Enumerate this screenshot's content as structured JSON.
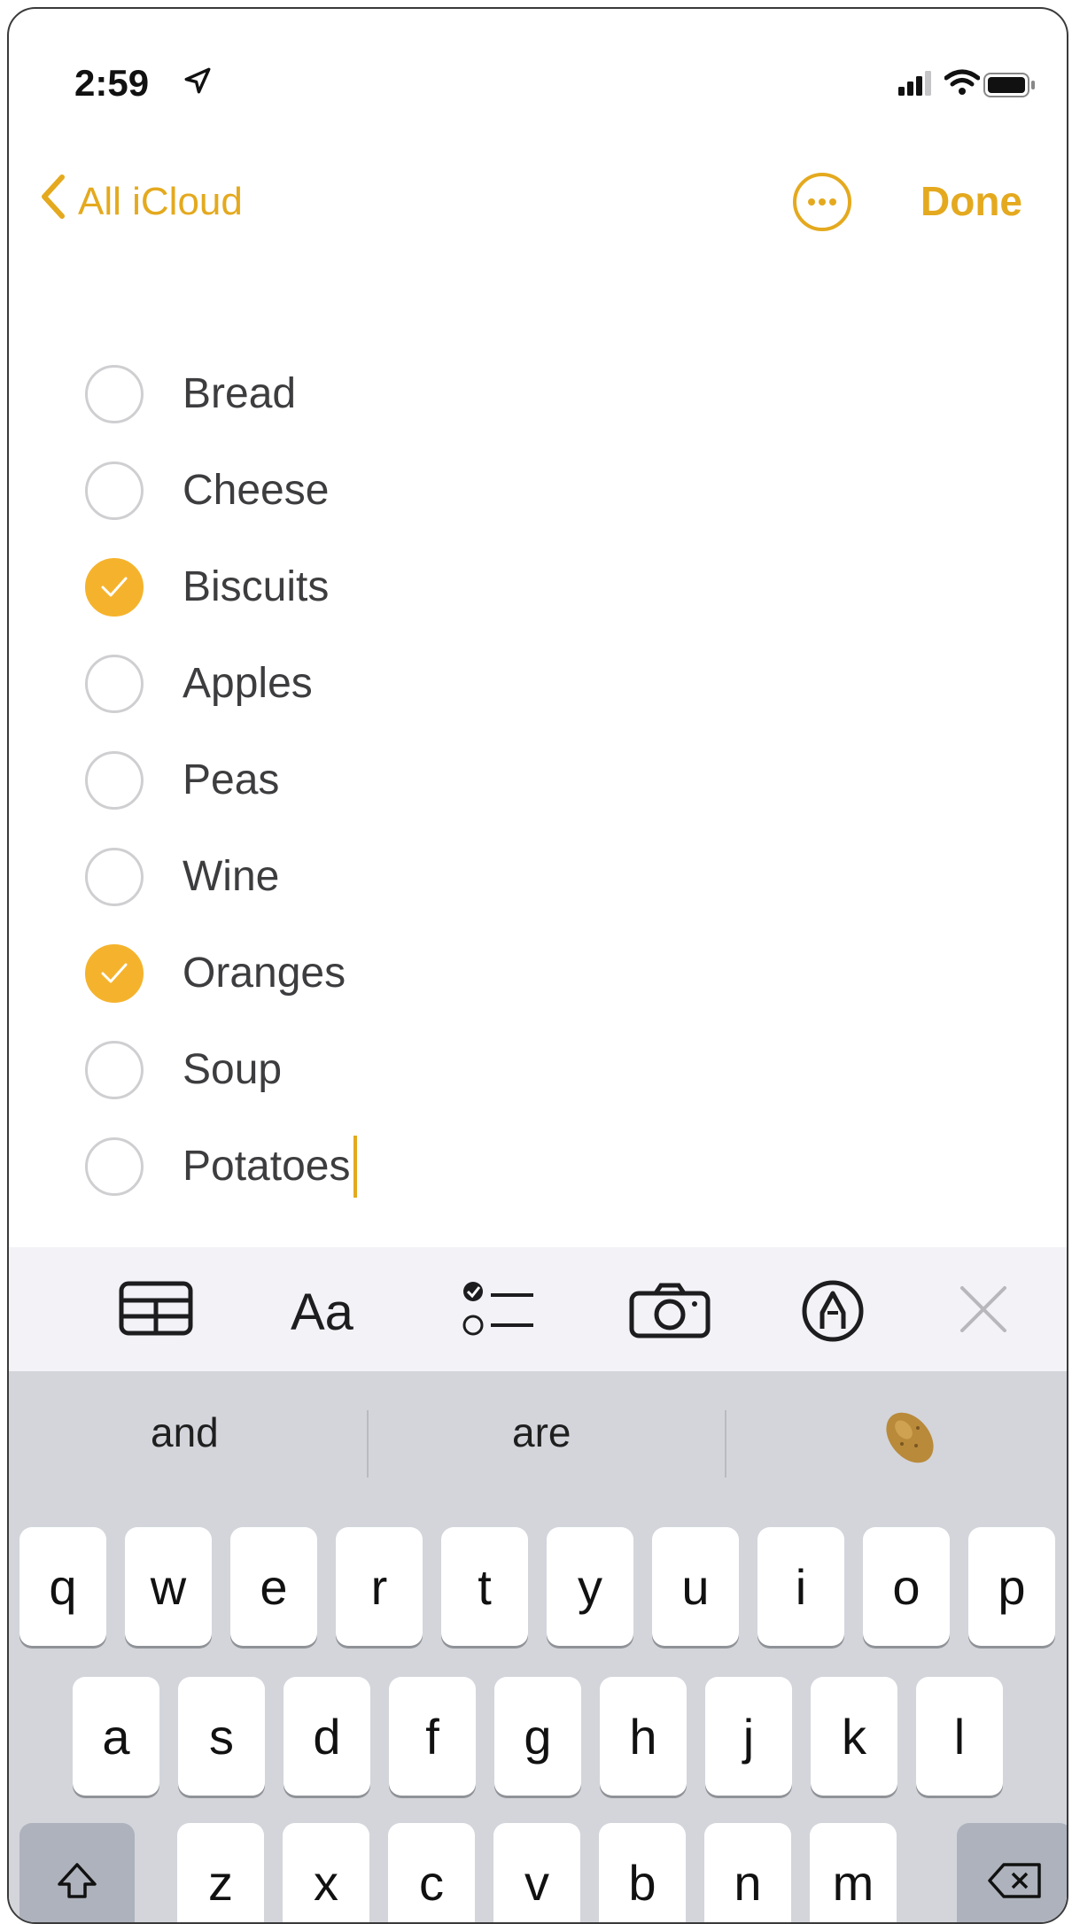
{
  "status_bar": {
    "time": "2:59",
    "icons": [
      "location-arrow-icon",
      "cellular-signal-icon",
      "wifi-icon",
      "battery-icon"
    ]
  },
  "nav": {
    "back_label": "All iCloud",
    "done_label": "Done",
    "more_icon": "ellipsis-circle-icon",
    "accent_color": "#e4a91e"
  },
  "checklist": [
    {
      "label": "Bread",
      "checked": false
    },
    {
      "label": "Cheese",
      "checked": false
    },
    {
      "label": "Biscuits",
      "checked": true
    },
    {
      "label": "Apples",
      "checked": false
    },
    {
      "label": "Peas",
      "checked": false
    },
    {
      "label": "Wine",
      "checked": false
    },
    {
      "label": "Oranges",
      "checked": true
    },
    {
      "label": "Soup",
      "checked": false
    },
    {
      "label": "Potatoes",
      "checked": false
    }
  ],
  "toolbar": {
    "text_format_label": "Aa",
    "icons": [
      "table-icon",
      "text-format-icon",
      "checklist-icon",
      "camera-icon",
      "markup-pen-icon",
      "close-icon"
    ]
  },
  "keyboard": {
    "suggestions": [
      "and",
      "are"
    ],
    "suggestion_emoji": "potato-emoji",
    "row1": [
      "q",
      "w",
      "e",
      "r",
      "t",
      "y",
      "u",
      "i",
      "o",
      "p"
    ],
    "row2": [
      "a",
      "s",
      "d",
      "f",
      "g",
      "h",
      "j",
      "k",
      "l"
    ],
    "row3": [
      "z",
      "x",
      "c",
      "v",
      "b",
      "n",
      "m"
    ]
  }
}
